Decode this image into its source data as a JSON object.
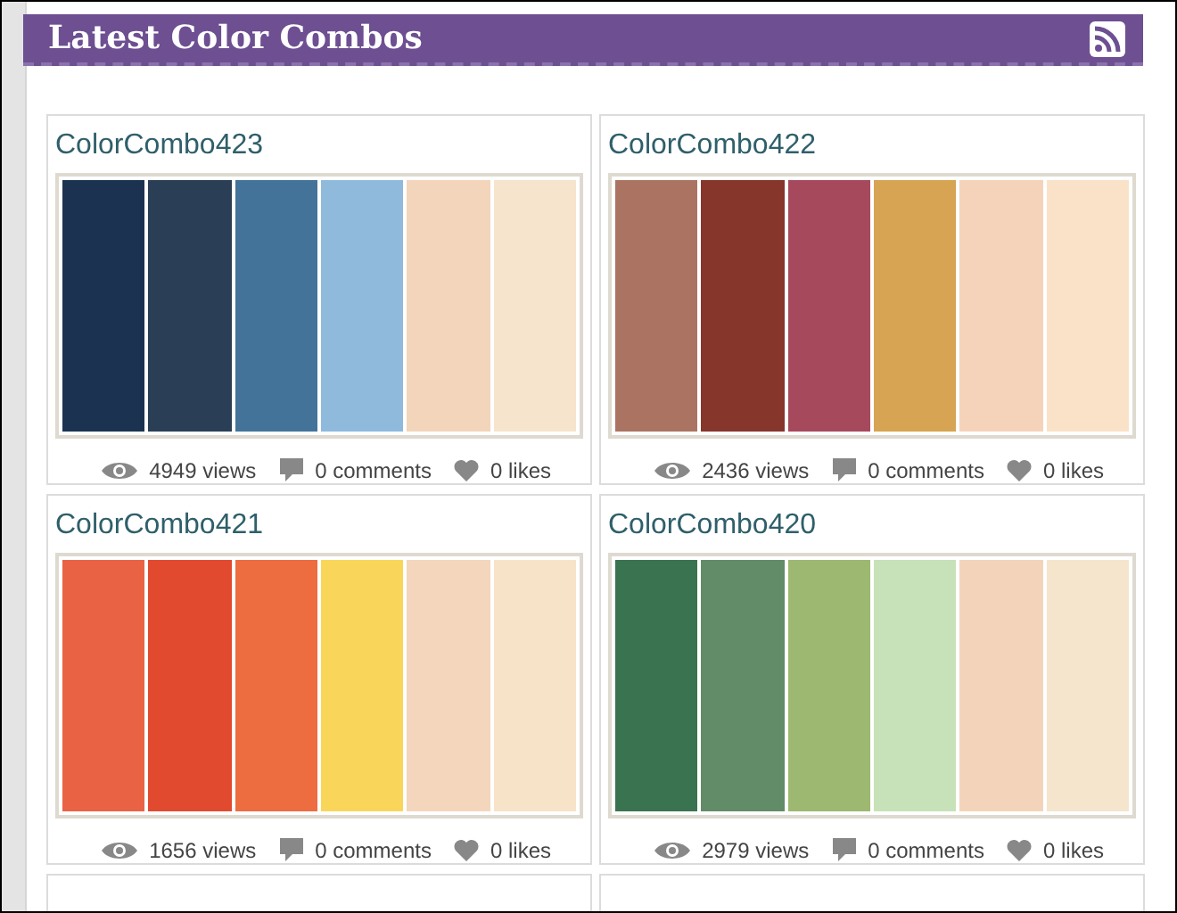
{
  "header": {
    "title": "Latest Color Combos"
  },
  "combos": [
    {
      "name": "ColorCombo423",
      "swatches": [
        {
          "color": "#1b3350"
        },
        {
          "color": "#2a3f55"
        },
        {
          "color": "#44739a"
        },
        {
          "color": "#8fbadc"
        },
        {
          "color": "#f3d5bb"
        },
        {
          "color": "#f6e4cc"
        }
      ],
      "views": "4949 views",
      "comments": "0 comments",
      "likes": "0 likes"
    },
    {
      "name": "ColorCombo422",
      "swatches": [
        {
          "color": "#ab7462"
        },
        {
          "color": "#87362b"
        },
        {
          "color": "#a7495d"
        },
        {
          "color": "#d6a452"
        },
        {
          "color": "#f5d3ba"
        },
        {
          "color": "#fae2c8"
        }
      ],
      "views": "2436 views",
      "comments": "0 comments",
      "likes": "0 likes"
    },
    {
      "name": "ColorCombo421",
      "swatches": [
        {
          "color": "#ea6244"
        },
        {
          "color": "#e24a30"
        },
        {
          "color": "#ed6c40"
        },
        {
          "color": "#f9d65a"
        },
        {
          "color": "#f3d6bc"
        },
        {
          "color": "#f7e3c8"
        }
      ],
      "views": "1656 views",
      "comments": "0 comments",
      "likes": "0 likes"
    },
    {
      "name": "ColorCombo420",
      "swatches": [
        {
          "color": "#3a7350"
        },
        {
          "color": "#628c67"
        },
        {
          "color": "#9db870"
        },
        {
          "color": "#c7e1b9"
        },
        {
          "color": "#f3d4bb"
        },
        {
          "color": "#f5e5cd"
        }
      ],
      "views": "2979 views",
      "comments": "0 comments",
      "likes": "0 likes"
    }
  ]
}
